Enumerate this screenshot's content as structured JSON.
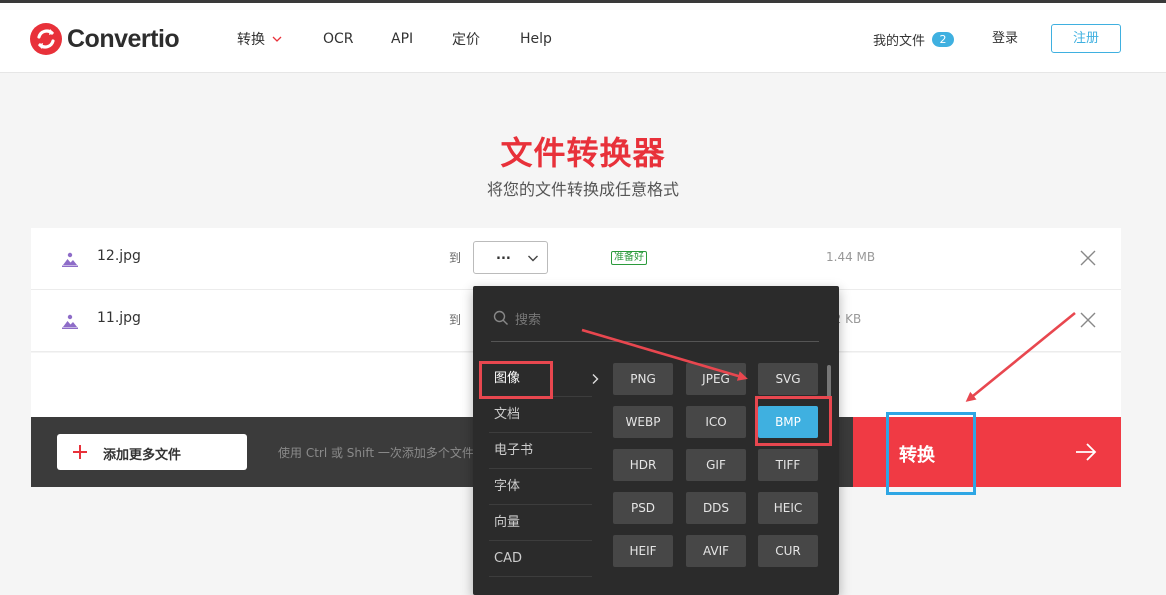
{
  "header": {
    "brand": "Convertio",
    "nav": [
      {
        "label": "转换",
        "has_dropdown": true
      },
      {
        "label": "OCR"
      },
      {
        "label": "API"
      },
      {
        "label": "定价"
      },
      {
        "label": "Help"
      }
    ],
    "my_files_label": "我的文件",
    "my_files_count": "2",
    "login_label": "登录",
    "signup_label": "注册"
  },
  "hero": {
    "title": "文件转换器",
    "subtitle": "将您的文件转换成任意格式"
  },
  "files": [
    {
      "name": "12.jpg",
      "to_label": "到",
      "format_value": "...",
      "status": "准备好",
      "size": "1.44 MB"
    },
    {
      "name": "11.jpg",
      "to_label": "到",
      "format_value": "",
      "status": "",
      "size": "22 KB"
    }
  ],
  "actions": {
    "add_more_label": "添加更多文件",
    "hint": "使用 Ctrl 或 Shift 一次添加多个文件",
    "convert_label": "转换"
  },
  "dropdown": {
    "search_placeholder": "搜索",
    "categories": [
      "图像",
      "文档",
      "电子书",
      "字体",
      "向量",
      "CAD"
    ],
    "active_category": "图像",
    "formats": [
      "PNG",
      "JPEG",
      "SVG",
      "WEBP",
      "ICO",
      "BMP",
      "HDR",
      "GIF",
      "TIFF",
      "PSD",
      "DDS",
      "HEIC",
      "HEIF",
      "AVIF",
      "CUR"
    ],
    "selected_format": "BMP"
  },
  "colors": {
    "brand_red": "#e8313a",
    "convert_red": "#f03a44",
    "accent_blue": "#3fb0e0",
    "annotation_red": "#e8474f",
    "annotation_blue": "#2ea6e4",
    "dark_bar": "#3b3b3b",
    "dropdown_bg": "#2b2b2b"
  }
}
